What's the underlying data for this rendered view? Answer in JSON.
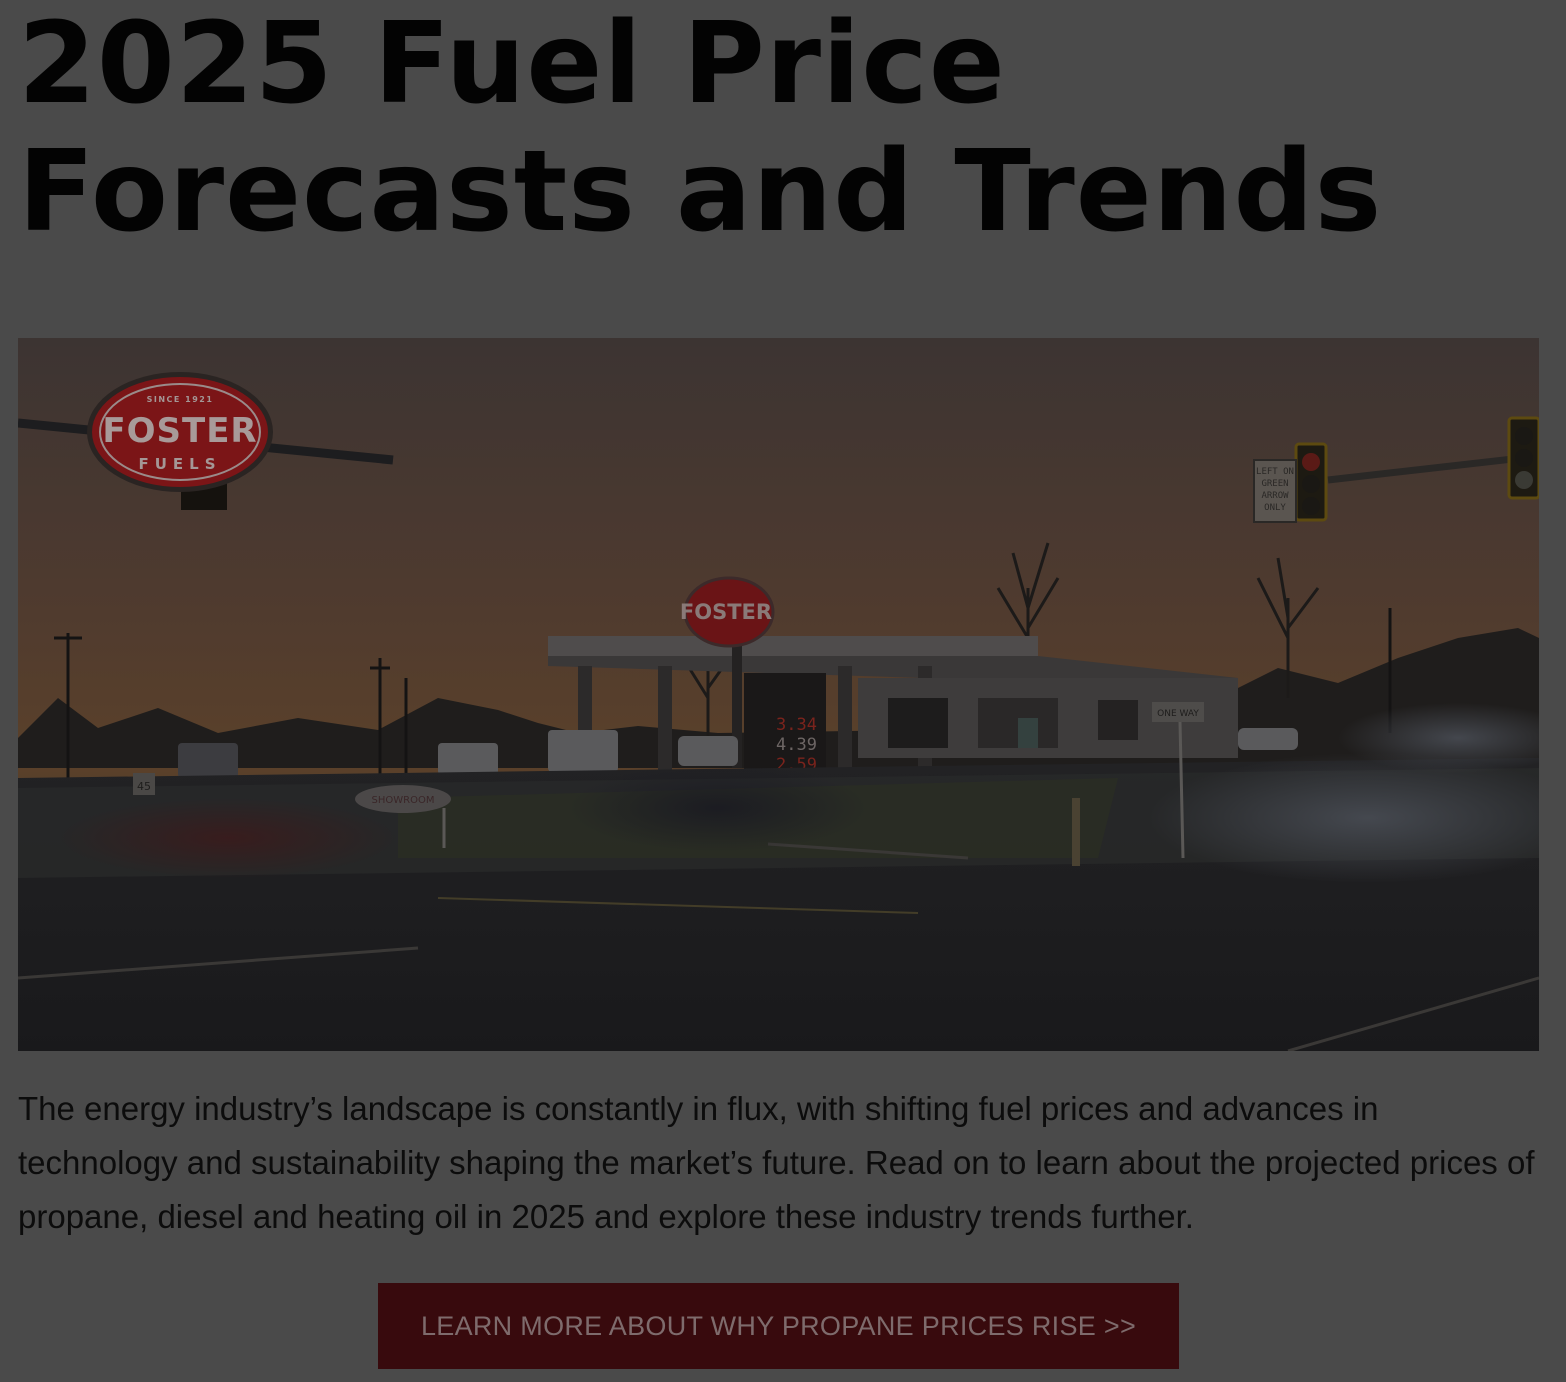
{
  "article": {
    "title": "2025 Fuel Price Forecasts and Trends",
    "intro": "The energy industry’s landscape is constantly in flux, with shifting fuel prices and advances in technology and sustainability shaping the market’s future. Read on to learn about the projected prices of propane, diesel and heating oil in 2025 and explore these industry trends further.",
    "cta_label": "LEARN MORE ABOUT WHY PROPANE PRICES RISE >>"
  },
  "hero": {
    "logo_since": "SINCE 1921",
    "logo_name": "FOSTER",
    "logo_sub": "FUELS",
    "station_sign": "FOSTER",
    "prices": [
      "3.34",
      "4.39",
      "2.59"
    ],
    "signal_sign": [
      "LEFT ON",
      "GREEN",
      "ARROW",
      "ONLY"
    ],
    "one_way_sign": "ONE WAY",
    "speed_sign": "45",
    "showroom_sign": "SHOWROOM"
  },
  "theme": {
    "background": "#4a4a4a",
    "cta_background": "#380a0d",
    "logo_red": "#7b1517"
  }
}
